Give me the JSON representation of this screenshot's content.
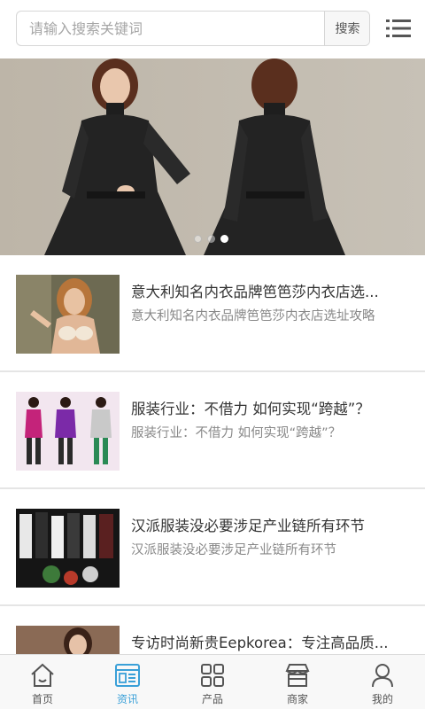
{
  "search": {
    "placeholder": "请输入搜索关键词",
    "button_label": "搜索"
  },
  "banner": {
    "slide_count": 3,
    "active_slide": 3
  },
  "articles": [
    {
      "title": "意大利知名内衣品牌笆笆莎内衣店选...",
      "subtitle": "意大利知名内衣品牌笆笆莎内衣店选址攻略"
    },
    {
      "title": "服装行业：不借力 如何实现“跨越”？",
      "subtitle": "服装行业：不借力 如何实现“跨越”？"
    },
    {
      "title": "汉派服装没必要涉足产业链所有环节",
      "subtitle": "汉派服装没必要涉足产业链所有环节"
    },
    {
      "title": "专访时尚新贵Eepkorea：专注高品质...",
      "subtitle": ""
    }
  ],
  "tabbar": {
    "items": [
      {
        "label": "首页",
        "icon": "home-icon"
      },
      {
        "label": "资讯",
        "icon": "news-icon",
        "active": true
      },
      {
        "label": "产品",
        "icon": "grid-icon"
      },
      {
        "label": "商家",
        "icon": "store-icon"
      },
      {
        "label": "我的",
        "icon": "user-icon"
      }
    ]
  },
  "colors": {
    "accent": "#3aa0d8",
    "tab_default": "#555555",
    "divider": "#e5e5e5"
  }
}
